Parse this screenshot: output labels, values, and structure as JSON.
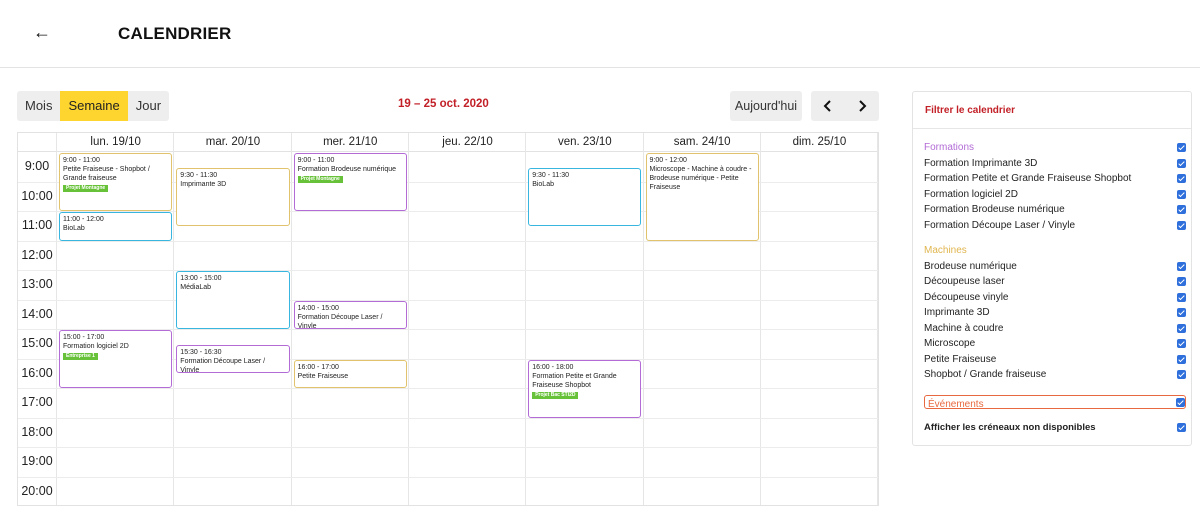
{
  "header": {
    "back_icon": "arrow-left-icon",
    "title": "CALENDRIER"
  },
  "toolbar": {
    "views": [
      "Mois",
      "Semaine",
      "Jour"
    ],
    "active_view": "Semaine",
    "date_range": "19 – 25 oct. 2020",
    "today_label": "Aujourd'hui",
    "prev_icon": "chevron-left-icon",
    "next_icon": "chevron-right-icon",
    "accent_color": "#fed52e",
    "range_color": "#c22027"
  },
  "calendar": {
    "days": [
      "lun. 19/10",
      "mar. 20/10",
      "mer. 21/10",
      "jeu. 22/10",
      "ven. 23/10",
      "sam. 24/10",
      "dim. 25/10"
    ],
    "hours": [
      "9:00",
      "10:00",
      "11:00",
      "12:00",
      "13:00",
      "14:00",
      "15:00",
      "16:00",
      "17:00",
      "18:00",
      "19:00",
      "20:00"
    ],
    "events": [
      {
        "day": 0,
        "start": 9,
        "end": 11,
        "time": "9:00 - 11:00",
        "title": "Petite Fraiseuse - Shopbot / Grande fraiseuse",
        "badge": "Projet Montagne",
        "kind": "machine"
      },
      {
        "day": 0,
        "start": 11,
        "end": 12,
        "time": "11:00 - 12:00",
        "title": "BioLab",
        "badge": "",
        "kind": "blue"
      },
      {
        "day": 0,
        "start": 15,
        "end": 17,
        "time": "15:00 - 17:00",
        "title": "Formation logiciel 2D",
        "badge": "Entreprise 1",
        "kind": "formation"
      },
      {
        "day": 1,
        "start": 9.5,
        "end": 11.5,
        "time": "9:30 - 11:30",
        "title": "Imprimante 3D",
        "badge": "",
        "kind": "machine"
      },
      {
        "day": 1,
        "start": 13,
        "end": 15,
        "time": "13:00 - 15:00",
        "title": "MédiaLab",
        "badge": "",
        "kind": "blue"
      },
      {
        "day": 1,
        "start": 15.5,
        "end": 16.5,
        "time": "15:30 - 16:30",
        "title": "Formation Découpe Laser / Vinyle",
        "badge": "",
        "kind": "formation"
      },
      {
        "day": 2,
        "start": 9,
        "end": 11,
        "time": "9:00 - 11:00",
        "title": "Formation Brodeuse numérique",
        "badge": "Projet Montagne",
        "kind": "formation"
      },
      {
        "day": 2,
        "start": 14,
        "end": 15,
        "time": "14:00 - 15:00",
        "title": "Formation Découpe Laser / Vinyle",
        "badge": "",
        "kind": "formation"
      },
      {
        "day": 2,
        "start": 16,
        "end": 17,
        "time": "16:00 - 17:00",
        "title": "Petite Fraiseuse",
        "badge": "",
        "kind": "machine"
      },
      {
        "day": 4,
        "start": 9.5,
        "end": 11.5,
        "time": "9:30 - 11:30",
        "title": "BioLab",
        "badge": "",
        "kind": "blue"
      },
      {
        "day": 4,
        "start": 16,
        "end": 18,
        "time": "16:00 - 18:00",
        "title": "Formation Petite et Grande Fraiseuse Shopbot",
        "badge": "Projet Bac STI2D",
        "kind": "formation"
      },
      {
        "day": 5,
        "start": 9,
        "end": 12,
        "time": "9:00 - 12:00",
        "title": "Microscope - Machine à coudre - Brodeuse numérique - Petite Fraiseuse",
        "badge": "",
        "kind": "machine"
      }
    ]
  },
  "filter": {
    "title": "Filtrer le calendrier",
    "formations_label": "Formations",
    "formations": [
      "Formation Imprimante 3D",
      "Formation Petite et Grande Fraiseuse Shopbot",
      "Formation logiciel 2D",
      "Formation Brodeuse numérique",
      "Formation Découpe Laser / Vinyle"
    ],
    "machines_label": "Machines",
    "machines": [
      "Brodeuse numérique",
      "Découpeuse laser",
      "Découpeuse vinyle",
      "Imprimante 3D",
      "Machine à coudre",
      "Microscope",
      "Petite Fraiseuse",
      "Shopbot / Grande fraiseuse"
    ],
    "events_label": "Événements",
    "unavailable_label": "Afficher les créneaux non disponibles",
    "checkbox_color": "#2f6fdc",
    "formation_color": "#b36bd6",
    "machine_color": "#e0b54e",
    "event_color": "#e8693f"
  }
}
